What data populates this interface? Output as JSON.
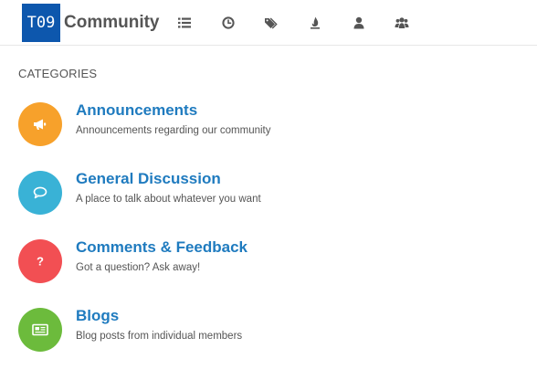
{
  "header": {
    "logo_text": "T09",
    "site_title": "Community",
    "nav_icons": [
      "list-icon",
      "clock-icon",
      "tags-icon",
      "fire-icon",
      "user-icon",
      "users-icon"
    ]
  },
  "main": {
    "section_heading": "CATEGORIES",
    "categories": [
      {
        "title": "Announcements",
        "description": "Announcements regarding our community",
        "icon": "bullhorn-icon",
        "color": "#f7a12b"
      },
      {
        "title": "General Discussion",
        "description": "A place to talk about whatever you want",
        "icon": "comments-icon",
        "color": "#39b2d6"
      },
      {
        "title": "Comments & Feedback",
        "description": "Got a question? Ask away!",
        "icon": "question-icon",
        "color": "#f24f53"
      },
      {
        "title": "Blogs",
        "description": "Blog posts from individual members",
        "icon": "newspaper-icon",
        "color": "#6cbb3c"
      }
    ]
  },
  "colors": {
    "logo_bg": "#0d57ad",
    "link": "#1f7bbf",
    "text": "#555555"
  }
}
